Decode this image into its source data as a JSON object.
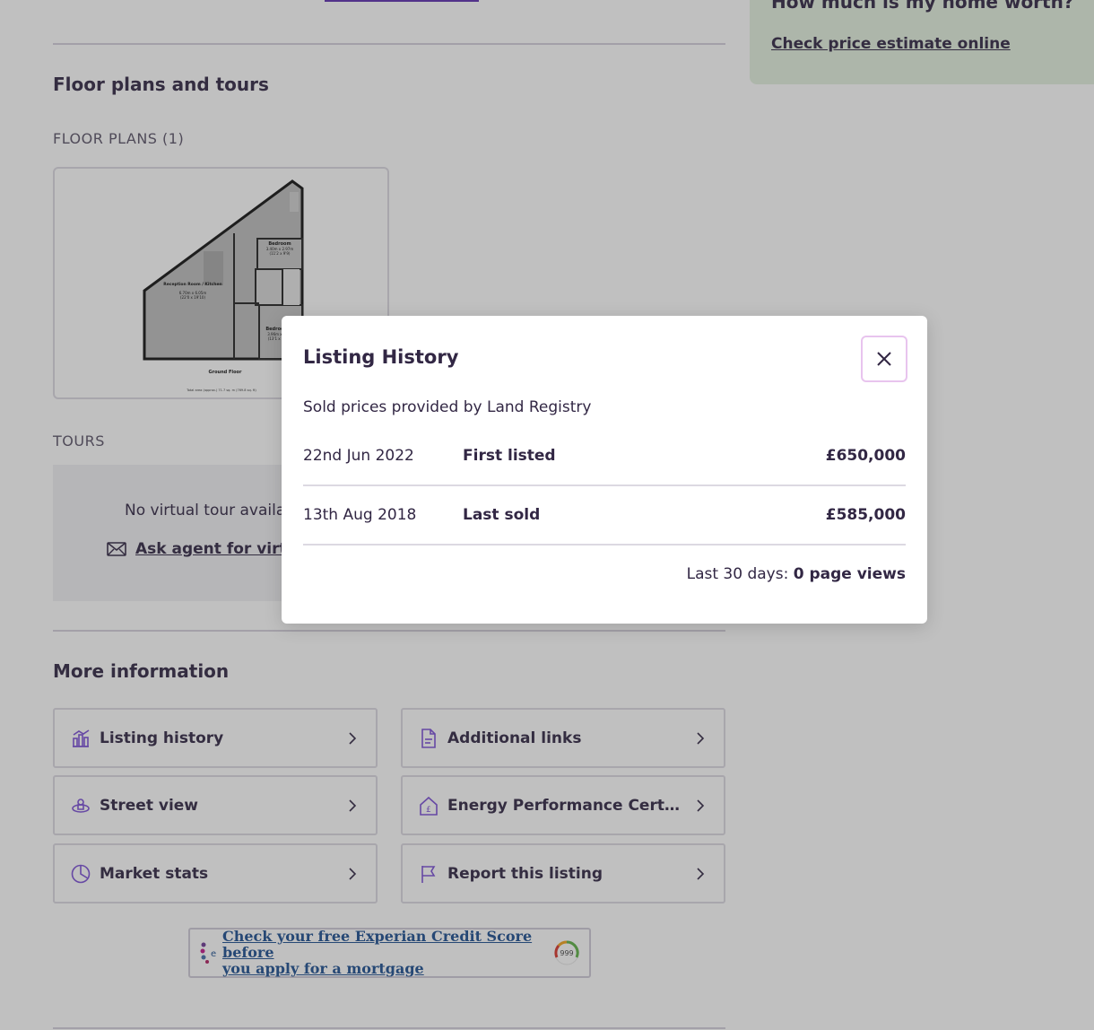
{
  "floor_section": {
    "title": "Floor plans and tours",
    "floorplans_label": "FLOOR PLANS (1)",
    "floorplan_rooms": [
      {
        "name": "Bedroom",
        "dims": "3.40m x 2.97m",
        "imperial": "(11'2 x 9'9)"
      },
      {
        "name": "Reception Room / Kitchen",
        "dims": "6.70m x 6.05m",
        "imperial": "(22'0 x 19'10)"
      },
      {
        "name": "Bedroom",
        "dims": "3.96m x ...",
        "imperial": "(13'1 x ...)"
      }
    ],
    "floorplan_floor": "Ground Floor",
    "floorplan_area": "Total area (approx.) 71.7 sq. m (769.8 sq. ft)",
    "tours_label": "TOURS",
    "no_tour_text": "No virtual tour available for this listing",
    "ask_agent_text": "Ask agent for virtual tour"
  },
  "more_info": {
    "title": "More information",
    "items": [
      {
        "label": "Listing history",
        "icon": "chart-icon"
      },
      {
        "label": "Additional links",
        "icon": "document-icon"
      },
      {
        "label": "Street view",
        "icon": "street-view-icon"
      },
      {
        "label": "Energy Performance Certificate (EPC)",
        "icon": "house-pound-icon"
      },
      {
        "label": "Market stats",
        "icon": "pie-chart-icon"
      },
      {
        "label": "Report this listing",
        "icon": "flag-icon"
      }
    ]
  },
  "experian": {
    "text_line1": "Check your free Experian Credit Score before",
    "text_line2": "you apply for a mortgage",
    "badge": "999"
  },
  "sidebar": {
    "question": "How much is my home worth?",
    "link": "Check price estimate online"
  },
  "modal": {
    "title": "Listing History",
    "source": "Sold prices provided by Land Registry",
    "rows": [
      {
        "date": "22nd Jun 2022",
        "event": "First listed",
        "price": "£650,000"
      },
      {
        "date": "13th Aug 2018",
        "event": "Last sold",
        "price": "£585,000"
      }
    ],
    "views_prefix": "Last 30 days:",
    "views_value": "0 page views"
  },
  "colors": {
    "accent": "#7b4fd6",
    "text": "#322744",
    "side_card_bg": "#e4f1df"
  }
}
